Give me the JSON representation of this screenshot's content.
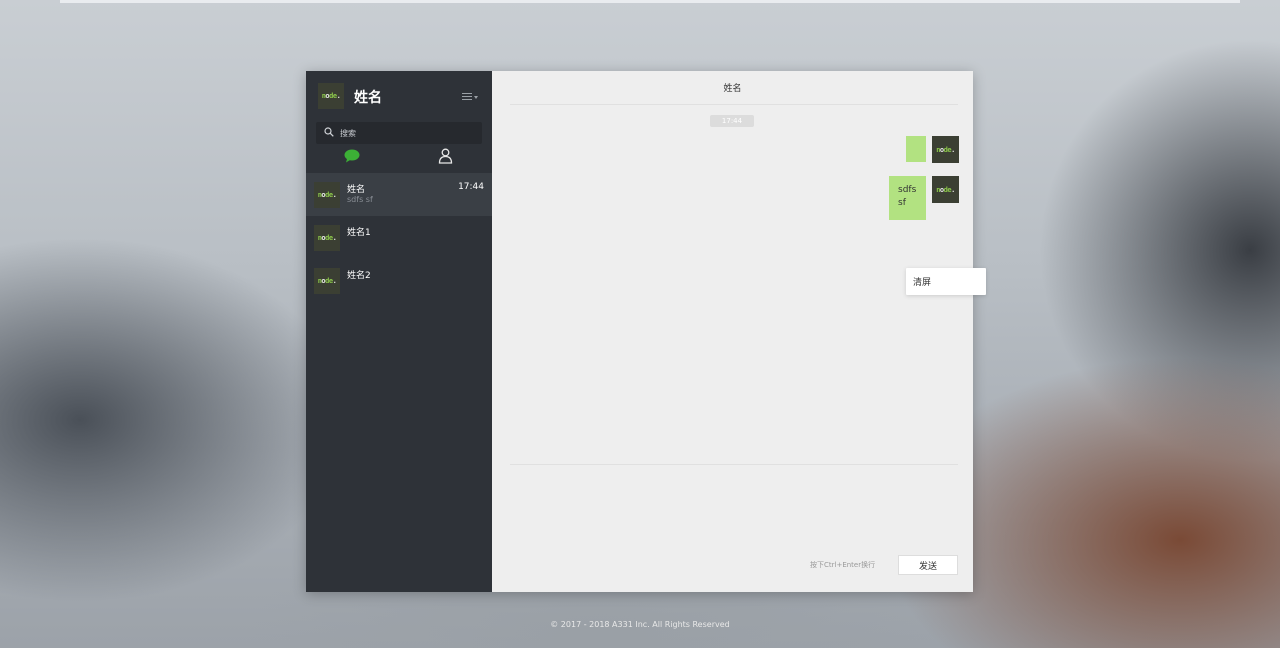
{
  "sidebar": {
    "user_name": "姓名",
    "avatar_text": "node",
    "search_placeholder": "搜索",
    "tabs": [
      {
        "icon": "chat-bubble-icon",
        "active": true
      },
      {
        "icon": "user-icon",
        "active": false
      }
    ],
    "conversations": [
      {
        "name": "姓名",
        "preview": "sdfs sf",
        "time": "17:44",
        "active": true
      },
      {
        "name": "姓名1",
        "preview": "",
        "time": "",
        "active": false
      },
      {
        "name": "姓名2",
        "preview": "",
        "time": "",
        "active": false
      }
    ]
  },
  "chat": {
    "title": "姓名",
    "time_badge": "17:44",
    "messages": [
      {
        "text": "",
        "self": true
      },
      {
        "text": "sdfs sf",
        "self": true
      }
    ],
    "context_menu": {
      "item": "清屏"
    },
    "input_hint": "按下Ctrl+Enter换行",
    "send_label": "发送"
  },
  "footer": {
    "text": "© 2017 - 2018 A331 Inc. All Rights Reserved"
  },
  "colors": {
    "sidebar_bg": "#2e3238",
    "active_item": "#3a3f45",
    "chat_bg": "#eeeeee",
    "bubble_self": "#b2e281",
    "accent_green": "#3caf36"
  }
}
